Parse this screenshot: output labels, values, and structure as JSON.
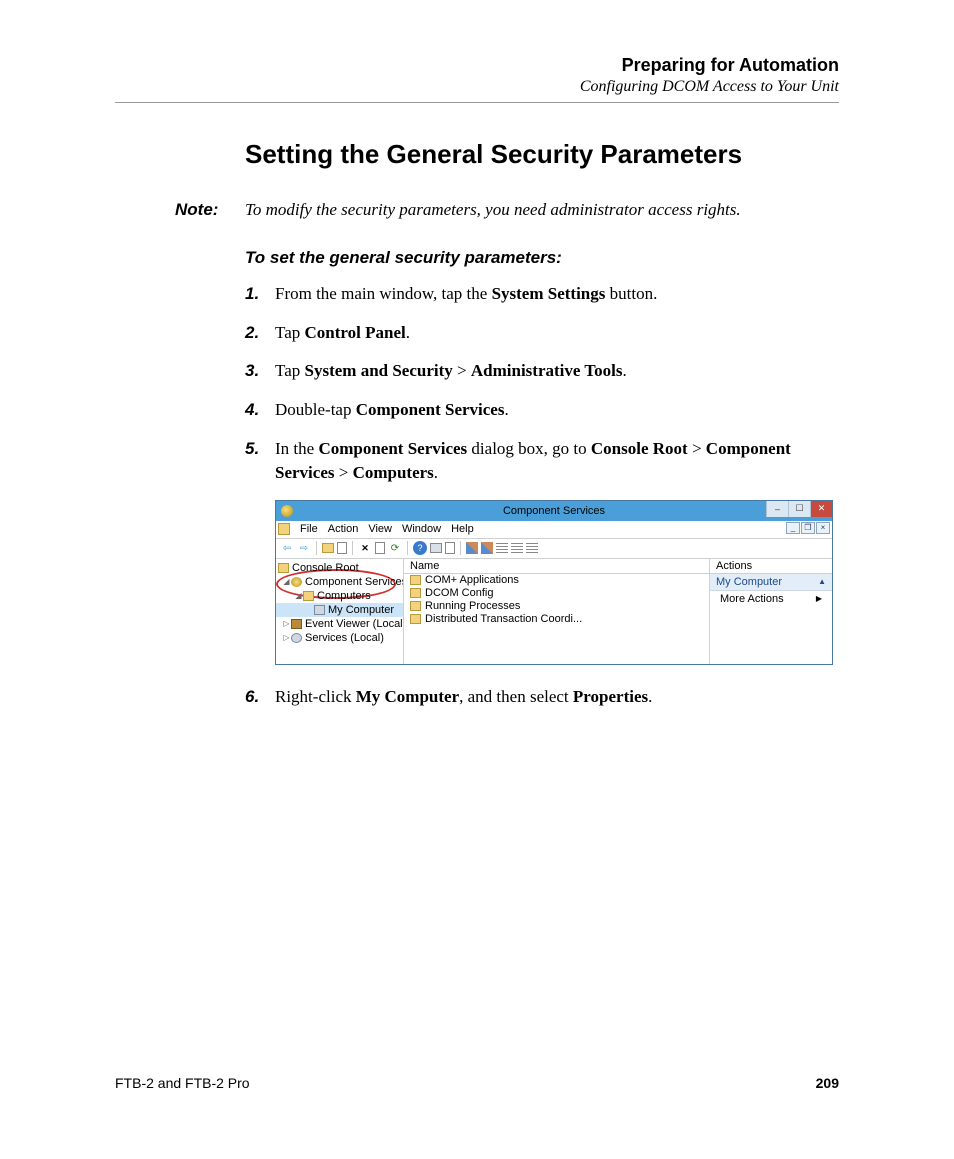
{
  "header": {
    "chapter": "Preparing for Automation",
    "section": "Configuring DCOM Access to Your Unit"
  },
  "heading": "Setting the General Security Parameters",
  "note": {
    "label": "Note:",
    "text": "To modify the security parameters, you need administrator access rights."
  },
  "subhead": "To set the general security parameters:",
  "steps": [
    {
      "n": "1.",
      "pre": "From the main window, tap the ",
      "b1": "System Settings",
      "post": " button."
    },
    {
      "n": "2.",
      "pre": "Tap ",
      "b1": "Control Panel",
      "post": "."
    },
    {
      "n": "3.",
      "pre": "Tap ",
      "b1": "System and Security",
      "mid": " > ",
      "b2": "Administrative Tools",
      "post": "."
    },
    {
      "n": "4.",
      "pre": "Double-tap ",
      "b1": "Component Services",
      "post": "."
    },
    {
      "n": "5.",
      "pre": "In the ",
      "b1": "Component Services",
      "mid": " dialog box, go to ",
      "b2": "Console Root",
      "mid2": " > ",
      "b3": "Component Services",
      "mid3": " > ",
      "b4": "Computers",
      "post": "."
    },
    {
      "n": "6.",
      "pre": "Right-click ",
      "b1": "My Computer",
      "mid": ", and then select ",
      "b2": "Properties",
      "post": "."
    }
  ],
  "screenshot": {
    "title": "Component Services",
    "menus": [
      "File",
      "Action",
      "View",
      "Window",
      "Help"
    ],
    "tree": {
      "root": "Console Root",
      "compsvc": "Component Services",
      "computers": "Computers",
      "mycomp": "My Computer",
      "evtviewer": "Event Viewer (Local)",
      "services": "Services (Local)"
    },
    "list": {
      "header": "Name",
      "items": [
        "COM+ Applications",
        "DCOM Config",
        "Running Processes",
        "Distributed Transaction Coordi..."
      ]
    },
    "actions": {
      "header": "Actions",
      "section": "My Computer",
      "item": "More Actions"
    }
  },
  "footer": {
    "product": "FTB-2 and FTB-2 Pro",
    "page": "209"
  }
}
